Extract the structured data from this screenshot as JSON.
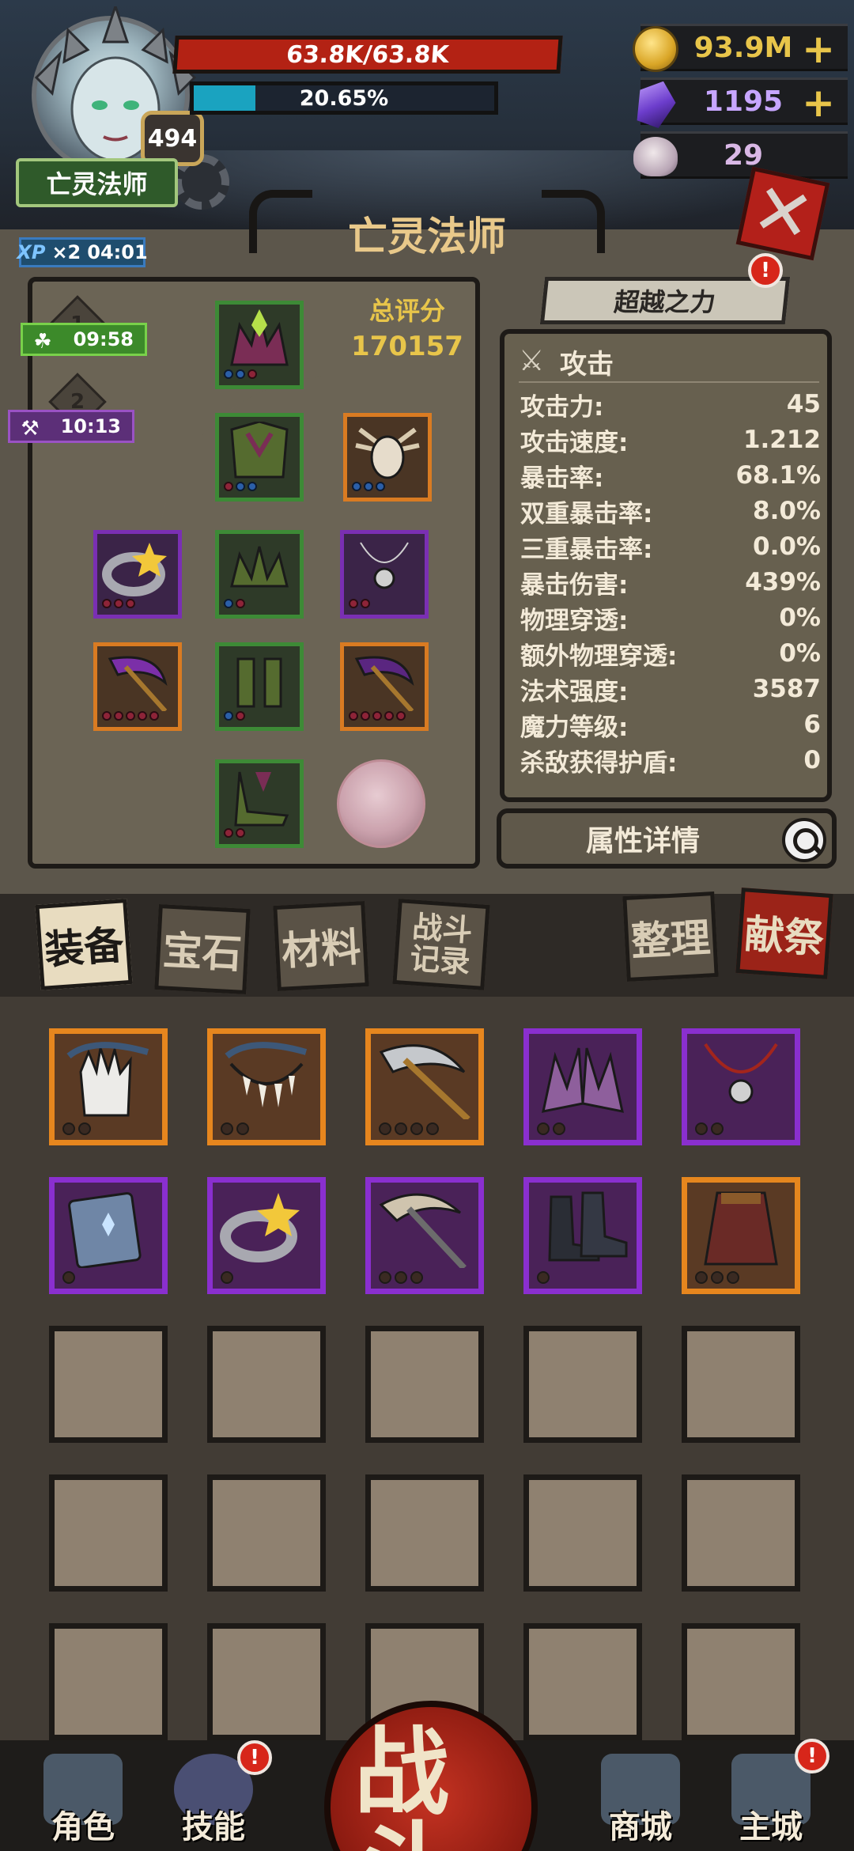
{
  "player": {
    "name": "亡灵法师",
    "level": "494",
    "hp_text": "63.8K/63.8K",
    "xp_text": "20.65%",
    "xp_fraction": 0.2065
  },
  "currencies": {
    "gold": "93.9M",
    "crystals": "1195",
    "skulls": "29",
    "plus": "+"
  },
  "title": "亡灵法师",
  "boosts": {
    "xp_multiplier_label": "XP",
    "xp_multiplier": "×2",
    "xp_timer": "04:01",
    "luck_timer": "09:58",
    "forge_timer": "10:13",
    "tier1": "1",
    "tier2": "2"
  },
  "score": {
    "label": "总评分",
    "value": "170157"
  },
  "transcend": {
    "label": "超越之力",
    "alert": "!"
  },
  "stats": {
    "header": "攻击",
    "rows": [
      {
        "label": "攻击力:",
        "value": "45"
      },
      {
        "label": "攻击速度:",
        "value": "1.212"
      },
      {
        "label": "暴击率:",
        "value": "68.1%"
      },
      {
        "label": "双重暴击率:",
        "value": "8.0%"
      },
      {
        "label": "三重暴击率:",
        "value": "0.0%"
      },
      {
        "label": "暴击伤害:",
        "value": "439%"
      },
      {
        "label": "物理穿透:",
        "value": "0%"
      },
      {
        "label": "额外物理穿透:",
        "value": "0%"
      },
      {
        "label": "法术强度:",
        "value": "3587"
      },
      {
        "label": "魔力等级:",
        "value": "6"
      },
      {
        "label": "杀敌获得护盾:",
        "value": "0"
      }
    ],
    "details_label": "属性详情"
  },
  "tabs": {
    "equipment": "装备",
    "gems": "宝石",
    "materials": "材料",
    "battle_log": "战斗记录",
    "sort": "整理",
    "sacrifice": "献祭"
  },
  "nav": {
    "character": "角色",
    "skills": "技能",
    "battle": "战斗",
    "shop": "商城",
    "main_city": "主城",
    "alert": "!"
  },
  "colors": {
    "rarity_orange": "#e6861e",
    "rarity_purple": "#8a2fcf",
    "rarity_green": "#3d8a36",
    "hp_red": "#b32214",
    "xp_cyan": "#1aa3c0",
    "accent_gold": "#e8c54a"
  }
}
